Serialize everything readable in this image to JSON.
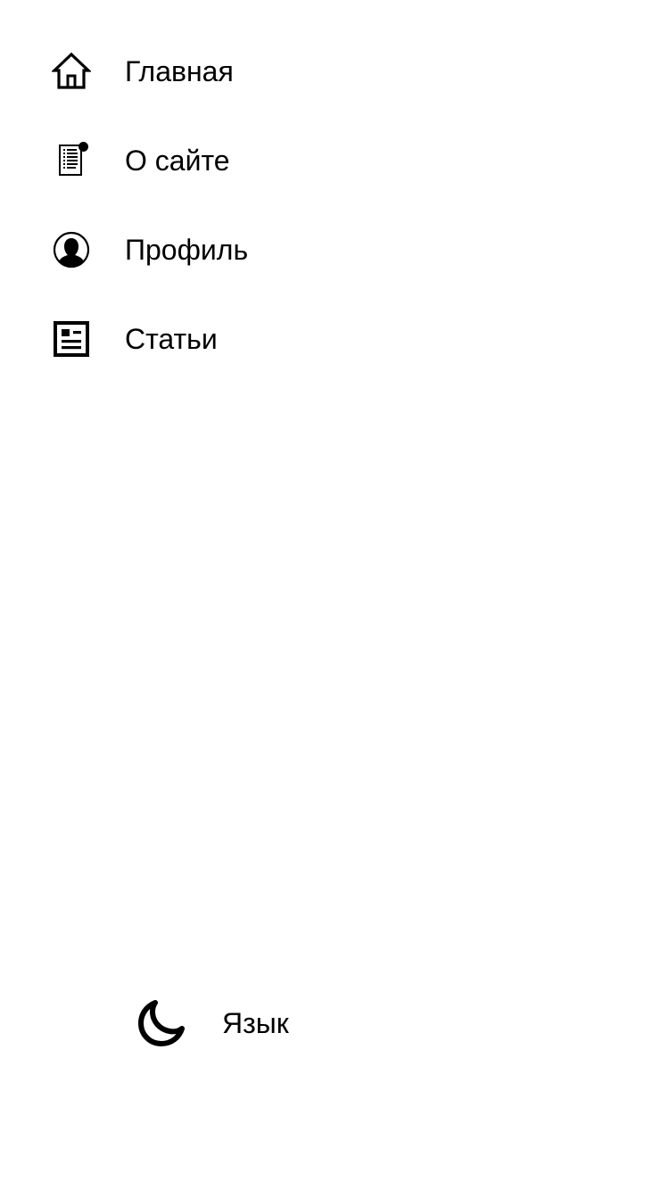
{
  "nav": {
    "items": [
      {
        "label": "Главная",
        "icon": "home-icon"
      },
      {
        "label": "О сайте",
        "icon": "about-document-icon"
      },
      {
        "label": "Профиль",
        "icon": "profile-icon"
      },
      {
        "label": "Статьи",
        "icon": "articles-icon"
      }
    ]
  },
  "footer": {
    "theme_icon": "moon-icon",
    "language_label": "Язык"
  },
  "colors": {
    "background": "#ffffff",
    "text": "#000000"
  }
}
